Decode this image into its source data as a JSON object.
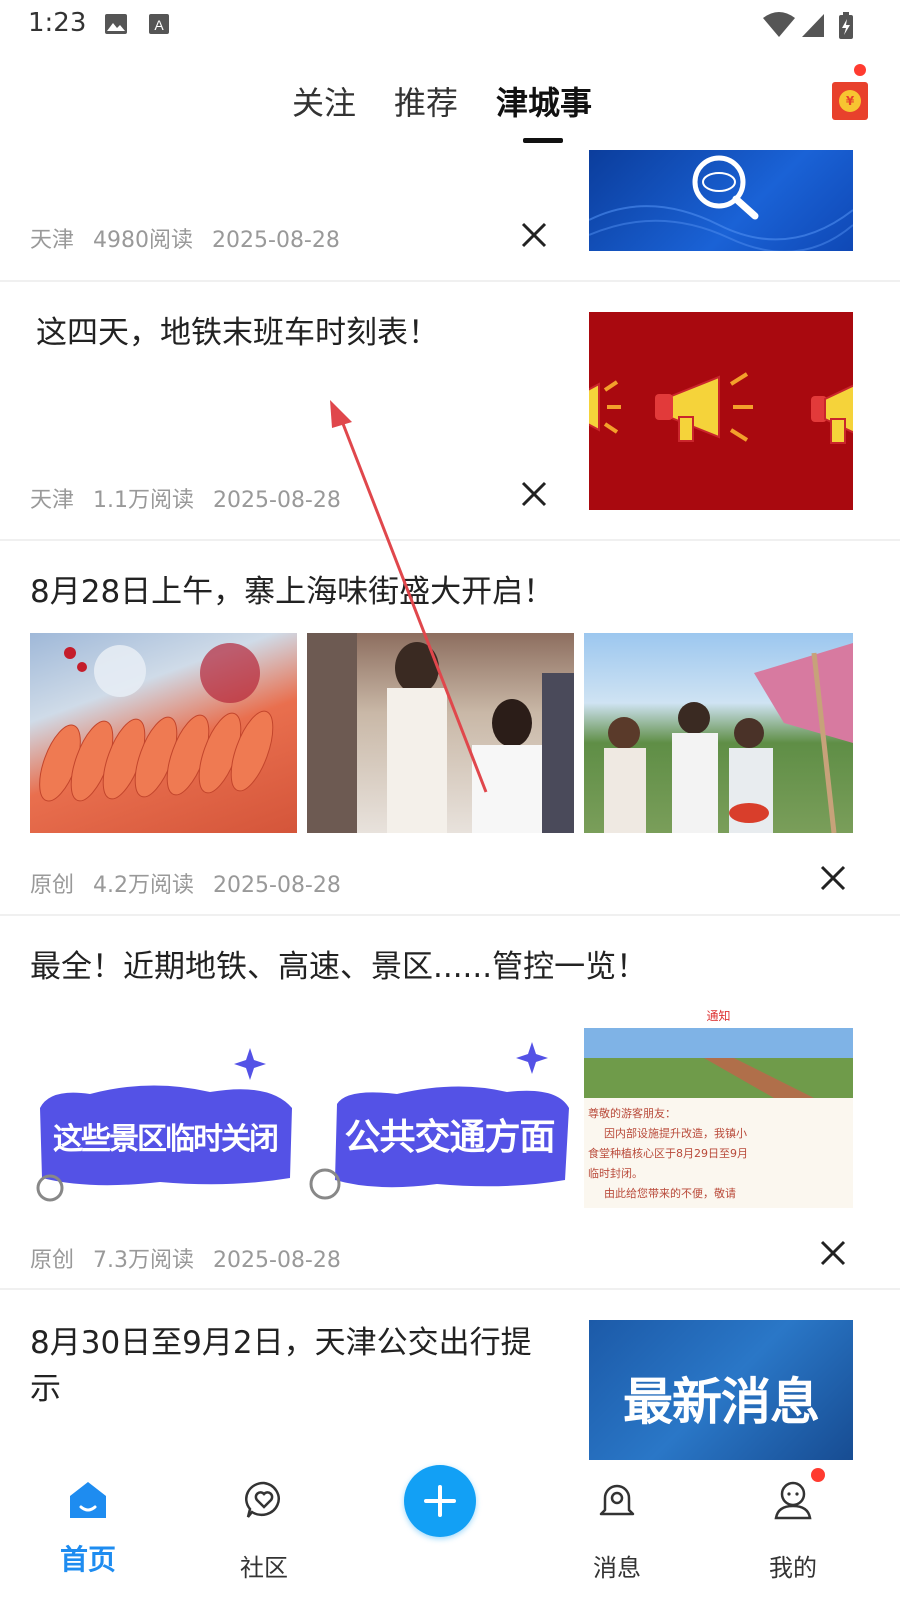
{
  "status_bar": {
    "time": "1:23"
  },
  "header": {
    "tabs": [
      {
        "label": "关注"
      },
      {
        "label": "推荐"
      },
      {
        "label": "津城事"
      }
    ],
    "active_tab": "津城事"
  },
  "articles": [
    {
      "source": "天津",
      "reads": "4980阅读",
      "date": "2025-08-28",
      "thumb_icon": "magnifier-logo-icon"
    },
    {
      "title": "这四天，地铁末班车时刻表！",
      "source": "天津",
      "reads": "1.1万阅读",
      "date": "2025-08-28",
      "thumb_icon": "megaphone-icon"
    },
    {
      "title": "8月28日上午，寨上海味街盛大开启！",
      "source": "原创",
      "reads": "4.2万阅读",
      "date": "2025-08-28",
      "images": [
        "shrimp-photo",
        "boy-at-market-photo",
        "crowd-at-stall-photo"
      ]
    },
    {
      "title": "最全！近期地铁、高速、景区......管控一览！",
      "source": "原创",
      "reads": "7.3万阅读",
      "date": "2025-08-28",
      "image_texts": [
        "这些景区临时关闭",
        "公共交通方面"
      ],
      "notice_header": "通知",
      "notice_lines": [
        "尊敬的游客朋友：",
        "因内部设施提升改造，我镇小",
        "食堂种植核心区于8月29日至9月",
        "临时封闭。",
        "由此给您带来的不便，敬请"
      ]
    },
    {
      "title": "8月30日至9月2日，天津公交出行提示",
      "thumb_text": "最新消息"
    }
  ],
  "bottom_nav": [
    {
      "label": "首页",
      "icon": "home-icon",
      "active": true
    },
    {
      "label": "社区",
      "icon": "chat-heart-icon",
      "active": false
    },
    {
      "label": "",
      "icon": "plus-icon",
      "active": false
    },
    {
      "label": "消息",
      "icon": "bell-icon",
      "active": false
    },
    {
      "label": "我的",
      "icon": "profile-icon",
      "active": false
    }
  ],
  "colors": {
    "accent": "#1e8cf0",
    "red_packet": "#e8412c",
    "badge": "#ff3b30",
    "gesture_arrow": "#e0474c"
  }
}
